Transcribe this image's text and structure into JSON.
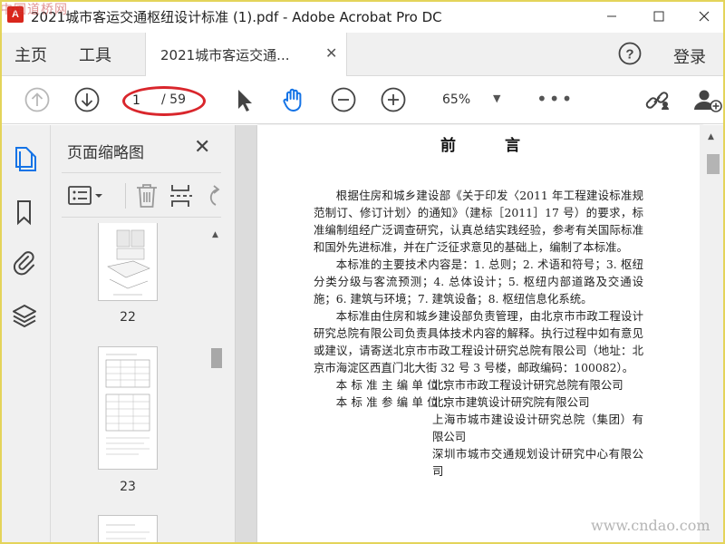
{
  "window": {
    "title": "2021城市客运交通枢纽设计标准 (1).pdf - Adobe Acrobat Pro DC"
  },
  "watermarks": {
    "top_left": "中国道桥网",
    "bottom_right": "www.cndao.com"
  },
  "menu": {
    "home": "主页",
    "tools": "工具",
    "tab_label": "2021城市客运交通...",
    "login": "登录"
  },
  "toolbar": {
    "current_page": "1",
    "total_pages": "/ 59",
    "zoom": "65%",
    "more": "•••"
  },
  "thumbnail_panel": {
    "title": "页面缩略图",
    "pages": [
      "22",
      "23"
    ]
  },
  "document": {
    "heading": "前 言",
    "paragraphs": [
      "根据住房和城乡建设部《关于印发〈2011 年工程建设标准规范制订、修订计划〉的通知》（建标［2011］17 号）的要求，标准编制组经广泛调查研究，认真总结实践经验，参考有关国际标准和国外先进标准，并在广泛征求意见的基础上，编制了本标准。",
      "本标准的主要技术内容是：1. 总则；2. 术语和符号；3. 枢纽分类分级与客流预测；4. 总体设计；5. 枢纽内部道路及交通设施；6. 建筑与环境；7. 建筑设备；8. 枢纽信息化系统。",
      "本标准由住房和城乡建设部负责管理，由北京市市政工程设计研究总院有限公司负责具体技术内容的解释。执行过程中如有意见或建议，请寄送北京市市政工程设计研究总院有限公司（地址：北京市海淀区西直门北大街 32 号 3 号楼，邮政编码：100082）。"
    ],
    "chief_editor_label": "本标准主编单位：",
    "chief_editor_value": "北京市市政工程设计研究总院有限公司",
    "co_editor_label": "本标准参编单位：",
    "co_editors": [
      "北京市建筑设计研究院有限公司",
      "上海市城市建设设计研究总院（集团）有限公司",
      "深圳市城市交通规划设计研究中心有限公司"
    ]
  },
  "colors": {
    "annotation_oval": "#d9262c",
    "brand_red": "#d9261c",
    "active_blue": "#1473e6"
  },
  "icons": {
    "rail": [
      "page-thumbnails-icon",
      "bookmark-icon",
      "attachment-icon",
      "layers-icon"
    ],
    "toolbar": [
      "page-up-icon",
      "page-down-icon",
      "select-arrow-icon",
      "hand-tool-icon",
      "zoom-out-icon",
      "zoom-in-icon",
      "share-link-icon",
      "add-user-icon"
    ]
  }
}
